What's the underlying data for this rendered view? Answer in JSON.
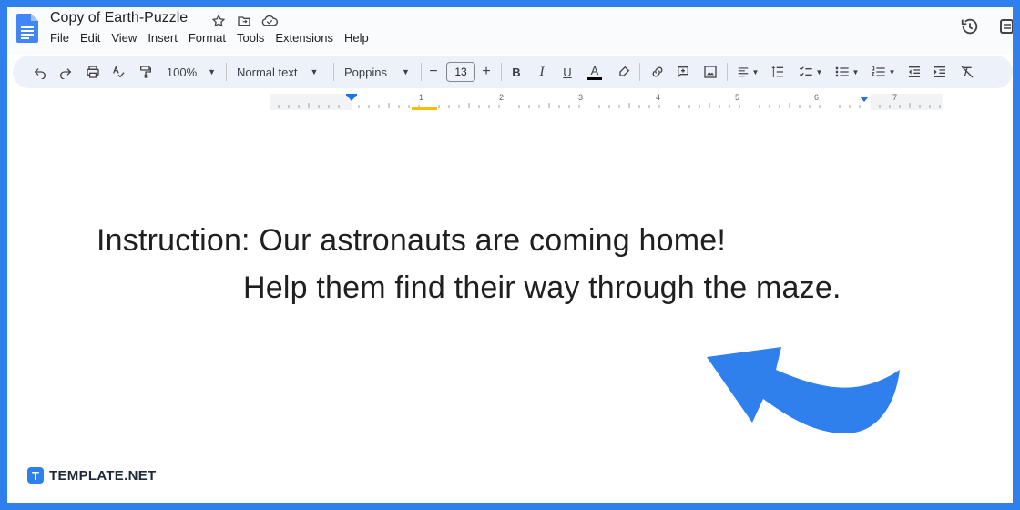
{
  "document": {
    "title": "Copy of Earth-Puzzle",
    "menu": [
      "File",
      "Edit",
      "View",
      "Insert",
      "Format",
      "Tools",
      "Extensions",
      "Help"
    ]
  },
  "toolbar": {
    "zoom": "100%",
    "style": "Normal text",
    "font": "Poppins",
    "font_size": "13"
  },
  "ruler": {
    "numbers": [
      "1",
      "2",
      "3",
      "4",
      "5",
      "6",
      "7"
    ]
  },
  "content": {
    "line1": "Instruction: Our astronauts are coming home!",
    "line2": "Help them find their way through the maze."
  },
  "watermark": {
    "mark": "T",
    "text": "TEMPLATE.NET"
  },
  "colors": {
    "frame": "#2f80ed",
    "arrow": "#2f80ed",
    "doc_icon": "#4285f4"
  },
  "icons": [
    "doc-icon",
    "star-icon",
    "move-to-folder-icon",
    "cloud-saved-icon",
    "history-icon",
    "comments-icon"
  ]
}
